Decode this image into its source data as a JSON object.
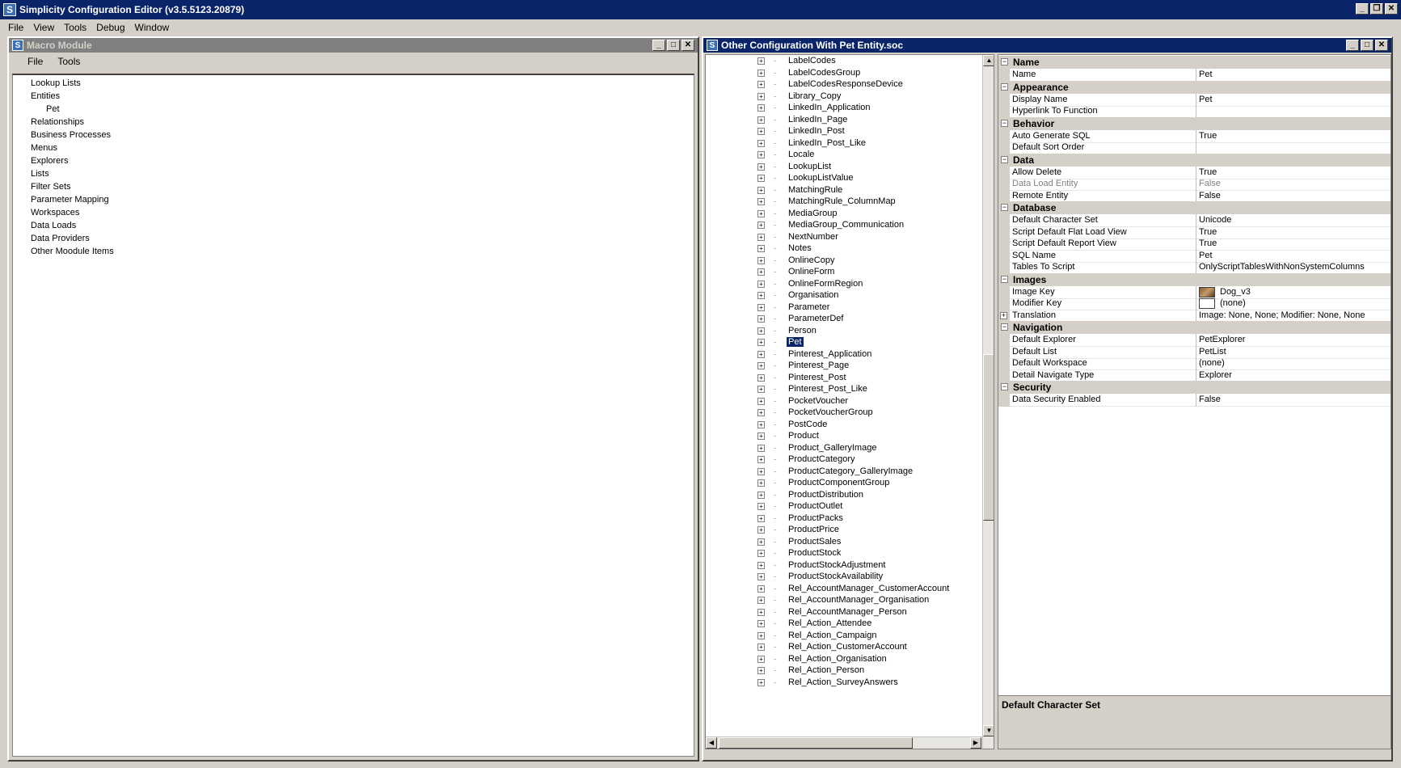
{
  "app": {
    "title": "Simplicity Configuration Editor (v3.5.5123.20879)",
    "menu": [
      "File",
      "View",
      "Tools",
      "Debug",
      "Window"
    ]
  },
  "macro_window": {
    "title": "Macro Module",
    "menu": [
      "File",
      "Tools"
    ],
    "tree": [
      {
        "label": "Lookup Lists",
        "level": 0
      },
      {
        "label": "Entities",
        "level": 0
      },
      {
        "label": "Pet",
        "level": 1
      },
      {
        "label": "Relationships",
        "level": 0
      },
      {
        "label": "Business Processes",
        "level": 0
      },
      {
        "label": "Menus",
        "level": 0
      },
      {
        "label": "Explorers",
        "level": 0
      },
      {
        "label": "Lists",
        "level": 0
      },
      {
        "label": "Filter Sets",
        "level": 0
      },
      {
        "label": "Parameter Mapping",
        "level": 0
      },
      {
        "label": "Workspaces",
        "level": 0
      },
      {
        "label": "Data Loads",
        "level": 0
      },
      {
        "label": "Data Providers",
        "level": 0
      },
      {
        "label": "Other Moodule Items",
        "level": 0
      }
    ]
  },
  "config_window": {
    "title": "Other Configuration With Pet Entity.soc",
    "entity_tree": {
      "selected": "Pet",
      "items": [
        "LabelCodes",
        "LabelCodesGroup",
        "LabelCodesResponseDevice",
        "Library_Copy",
        "LinkedIn_Application",
        "LinkedIn_Page",
        "LinkedIn_Post",
        "LinkedIn_Post_Like",
        "Locale",
        "LookupList",
        "LookupListValue",
        "MatchingRule",
        "MatchingRule_ColumnMap",
        "MediaGroup",
        "MediaGroup_Communication",
        "NextNumber",
        "Notes",
        "OnlineCopy",
        "OnlineForm",
        "OnlineFormRegion",
        "Organisation",
        "Parameter",
        "ParameterDef",
        "Person",
        "Pet",
        "Pinterest_Application",
        "Pinterest_Page",
        "Pinterest_Post",
        "Pinterest_Post_Like",
        "PocketVoucher",
        "PocketVoucherGroup",
        "PostCode",
        "Product",
        "Product_GalleryImage",
        "ProductCategory",
        "ProductCategory_GalleryImage",
        "ProductComponentGroup",
        "ProductDistribution",
        "ProductOutlet",
        "ProductPacks",
        "ProductPrice",
        "ProductSales",
        "ProductStock",
        "ProductStockAdjustment",
        "ProductStockAvailability",
        "Rel_AccountManager_CustomerAccount",
        "Rel_AccountManager_Organisation",
        "Rel_AccountManager_Person",
        "Rel_Action_Attendee",
        "Rel_Action_Campaign",
        "Rel_Action_CustomerAccount",
        "Rel_Action_Organisation",
        "Rel_Action_Person",
        "Rel_Action_SurveyAnswers"
      ]
    },
    "properties": [
      {
        "category": "Name",
        "rows": [
          {
            "name": "Name",
            "value": "Pet"
          }
        ]
      },
      {
        "category": "Appearance",
        "rows": [
          {
            "name": "Display Name",
            "value": "Pet"
          },
          {
            "name": "Hyperlink To Function",
            "value": ""
          }
        ]
      },
      {
        "category": "Behavior",
        "rows": [
          {
            "name": "Auto Generate SQL",
            "value": "True"
          },
          {
            "name": "Default Sort Order",
            "value": ""
          }
        ]
      },
      {
        "category": "Data",
        "rows": [
          {
            "name": "Allow Delete",
            "value": "True"
          },
          {
            "name": "Data Load Entity",
            "value": "False",
            "disabled": true
          },
          {
            "name": "Remote Entity",
            "value": "False"
          }
        ]
      },
      {
        "category": "Database",
        "rows": [
          {
            "name": "Default Character Set",
            "value": "Unicode"
          },
          {
            "name": "Script Default Flat Load View",
            "value": "True"
          },
          {
            "name": "Script Default Report View",
            "value": "True"
          },
          {
            "name": "SQL Name",
            "value": "Pet"
          },
          {
            "name": "Tables To Script",
            "value": "OnlyScriptTablesWithNonSystemColumns"
          }
        ]
      },
      {
        "category": "Images",
        "rows": [
          {
            "name": "Image Key",
            "value": "Dog_v3",
            "swatch": "dog"
          },
          {
            "name": "Modifier Key",
            "value": "(none)",
            "swatch": "none"
          },
          {
            "name": "Translation",
            "value": "Image: None, None; Modifier: None, None",
            "expandable": true
          }
        ]
      },
      {
        "category": "Navigation",
        "rows": [
          {
            "name": "Default Explorer",
            "value": "PetExplorer"
          },
          {
            "name": "Default List",
            "value": "PetList"
          },
          {
            "name": "Default Workspace",
            "value": "(none)"
          },
          {
            "name": "Detail Navigate Type",
            "value": "Explorer"
          }
        ]
      },
      {
        "category": "Security",
        "rows": [
          {
            "name": "Data Security Enabled",
            "value": "False"
          }
        ]
      }
    ],
    "description_title": "Default Character Set"
  }
}
